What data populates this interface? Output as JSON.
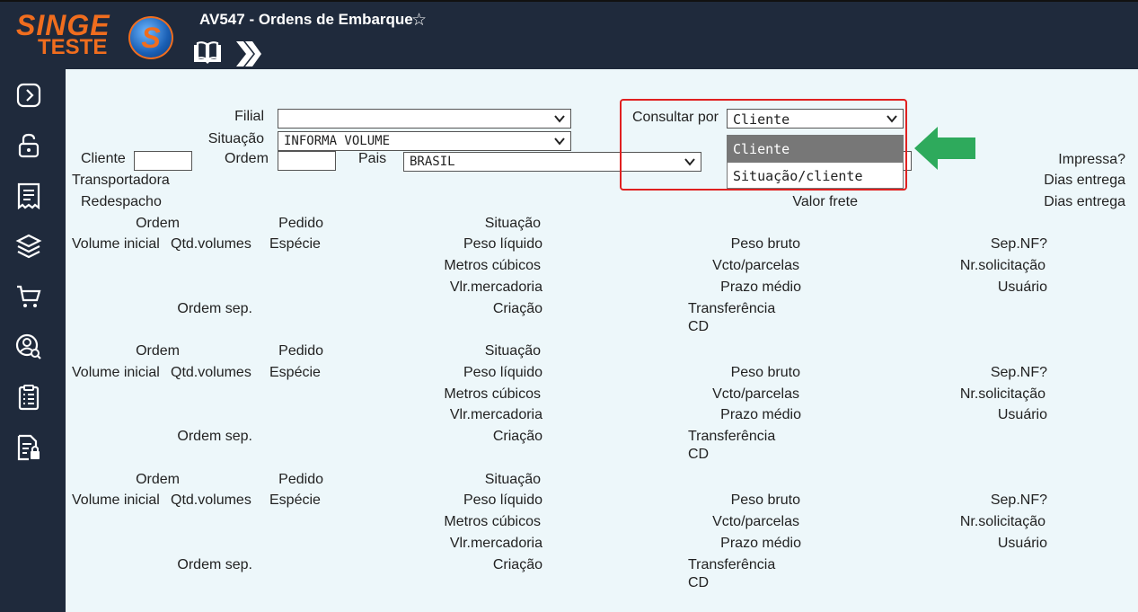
{
  "header": {
    "logo_line1": "SINGE",
    "logo_line2": "TESTE",
    "logo_letter": "S",
    "title": "AV547 - Ordens de Embarque",
    "star": "☆"
  },
  "sidebar": {
    "icons": [
      "expand-icon",
      "unlock-icon",
      "receipt-icon",
      "layers-icon",
      "cart-icon",
      "user-search-icon",
      "clipboard-icon",
      "document-lock-icon"
    ]
  },
  "filters": {
    "filial_label": "Filial",
    "filial_value": "",
    "situacao_label": "Situação",
    "situacao_value": "INFORMA VOLUME",
    "cliente_label": "Cliente",
    "ordem_label": "Ordem",
    "pais_label": "Pais",
    "pais_value": "BRASIL",
    "consultar_label": "Consultar por",
    "consultar_value": "Cliente",
    "consultar_options": [
      "Cliente",
      "Situação/cliente"
    ],
    "impressa_label": "Impressa?",
    "transportadora_label": "Transportadora",
    "dias_entrega_label_1": "Dias entrega",
    "redespacho_label": "Redespacho",
    "valor_frete_label": "Valor frete",
    "dias_entrega_label_2": "Dias entrega"
  },
  "record_labels": {
    "ordem": "Ordem",
    "pedido": "Pedido",
    "situacao": "Situação",
    "volume_inicial": "Volume inicial",
    "qtd_volumes": "Qtd.volumes",
    "especie": "Espécie",
    "peso_liquido": "Peso líquido",
    "peso_bruto": "Peso bruto",
    "sep_nf": "Sep.NF?",
    "metros_cubicos": "Metros cúbicos",
    "vcto_parcelas": "Vcto/parcelas",
    "nr_solicitacao": "Nr.solicitação",
    "vlr_mercadoria": "Vlr.mercadoria",
    "prazo_medio": "Prazo médio",
    "usuario": "Usuário",
    "ordem_sep": "Ordem sep.",
    "criacao": "Criação",
    "transferencia": "Transferência",
    "cd": "CD"
  },
  "colors": {
    "topbar": "#1f2a3c",
    "background": "#edf7fa",
    "logo": "#f06d1e",
    "highlight_box": "#e02020",
    "arrow": "#2eaa5c"
  }
}
